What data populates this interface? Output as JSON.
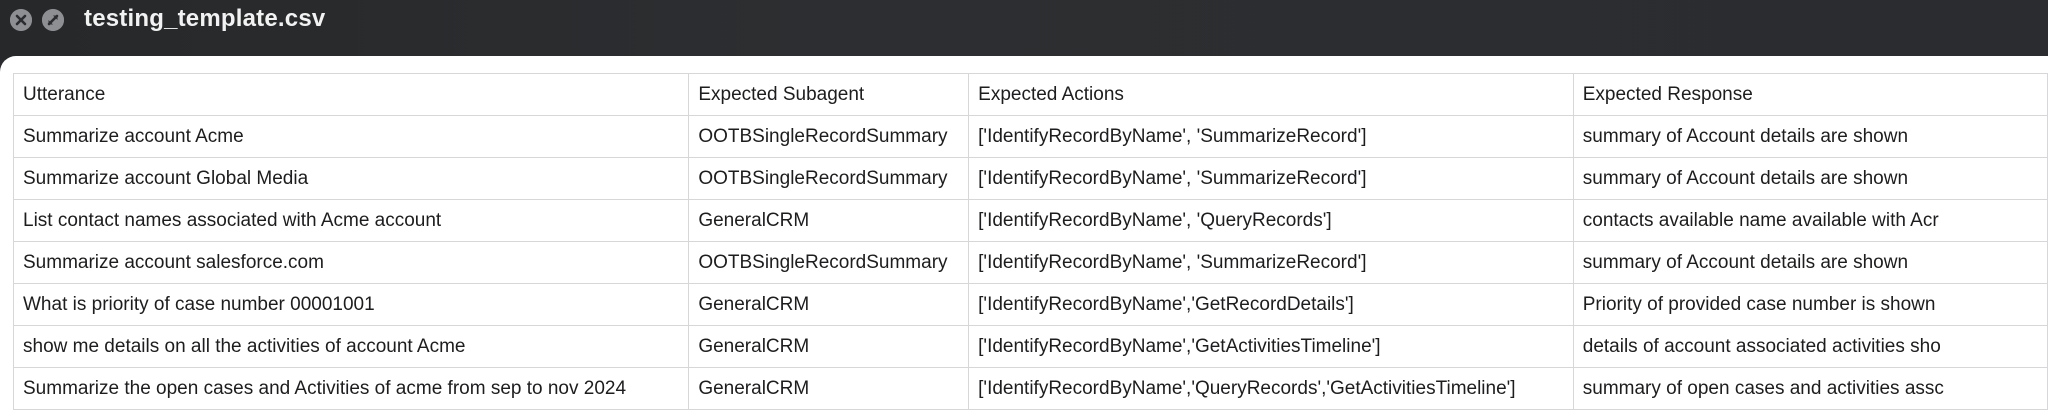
{
  "window": {
    "title": "testing_template.csv",
    "controls": [
      {
        "name": "close-icon"
      },
      {
        "name": "fullscreen-icon"
      }
    ]
  },
  "table": {
    "columns": [
      "Utterance",
      "Expected Subagent",
      "Expected Actions",
      "Expected Response"
    ],
    "rows": [
      [
        "Summarize account Acme",
        "OOTBSingleRecordSummary",
        "['IdentifyRecordByName', 'SummarizeRecord']",
        "summary of Account details are shown"
      ],
      [
        "Summarize account Global Media",
        "OOTBSingleRecordSummary",
        "['IdentifyRecordByName', 'SummarizeRecord']",
        "summary of Account details are shown"
      ],
      [
        "List contact names associated with Acme account",
        "GeneralCRM",
        "['IdentifyRecordByName', 'QueryRecords']",
        "contacts available name available with Acr"
      ],
      [
        "Summarize account salesforce.com",
        "OOTBSingleRecordSummary",
        "['IdentifyRecordByName', 'SummarizeRecord']",
        "summary of Account details are shown"
      ],
      [
        "What is priority of case number 00001001",
        "GeneralCRM",
        "['IdentifyRecordByName','GetRecordDetails']",
        "Priority of provided case number is shown"
      ],
      [
        "show me details on all the activities of account Acme",
        "GeneralCRM",
        "['IdentifyRecordByName','GetActivitiesTimeline']",
        "details of account associated activities sho"
      ],
      [
        "Summarize the open cases and Activities of acme from sep to nov 2024",
        "GeneralCRM",
        "['IdentifyRecordByName','QueryRecords','GetActivitiesTimeline']",
        "summary of open cases and activities assc"
      ]
    ]
  },
  "colors": {
    "titlebar": "#2a2c30",
    "title_text": "#f2f2f2",
    "grid_line": "#d7d7d9",
    "cell_text": "#1d1d1f"
  }
}
